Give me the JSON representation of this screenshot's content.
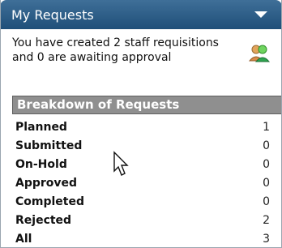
{
  "panel": {
    "title": "My Requests",
    "collapse_icon": "chevron-down-icon",
    "summary_text": "You have created 2 staff requisitions and 0 are awaiting approval",
    "summary_icon": "staff-people-icon"
  },
  "breakdown": {
    "title": "Breakdown of Requests",
    "rows": [
      {
        "label": "Planned",
        "count": "1"
      },
      {
        "label": "Submitted",
        "count": "0"
      },
      {
        "label": "On-Hold",
        "count": "0"
      },
      {
        "label": "Approved",
        "count": "0"
      },
      {
        "label": "Completed",
        "count": "0"
      },
      {
        "label": "Rejected",
        "count": "2"
      },
      {
        "label": "All",
        "count": "3"
      }
    ]
  },
  "colors": {
    "header_bg": "#2b5b86",
    "section_bg": "#8f8f8f",
    "text": "#111111"
  }
}
